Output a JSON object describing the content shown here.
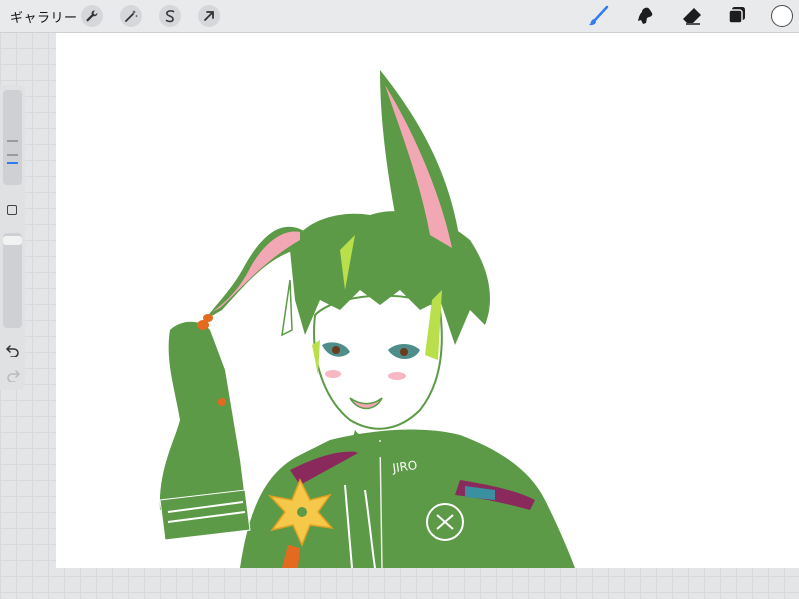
{
  "toolbar": {
    "gallery_label": "ギャラリー",
    "left_tools": [
      "wrench-icon",
      "magic-wand-icon",
      "selection-icon",
      "transform-arrow-icon"
    ],
    "right_tools": [
      "brush-icon",
      "smudge-icon",
      "eraser-icon",
      "layers-icon",
      "color-picker"
    ],
    "accent_color": "#2f7cf6",
    "current_color": "#ffffff"
  },
  "sidebar": {
    "brush_size_level": 0.3,
    "opacity_level": 0.05,
    "tools": [
      "size-slider",
      "modify-square-button",
      "opacity-slider",
      "undo-icon",
      "redo-icon"
    ]
  },
  "canvas": {
    "background": "#ffffff",
    "artwork": {
      "hair_color": "#5c9a47",
      "ear_inner_color": "#f2a8b4",
      "highlight_color": "#b9e04a",
      "flower_color": "#f5c84a",
      "nail_color": "#e46a1f",
      "hood_accent_color": "#8a2a5c",
      "jacket_lettering": "JIRO"
    }
  }
}
